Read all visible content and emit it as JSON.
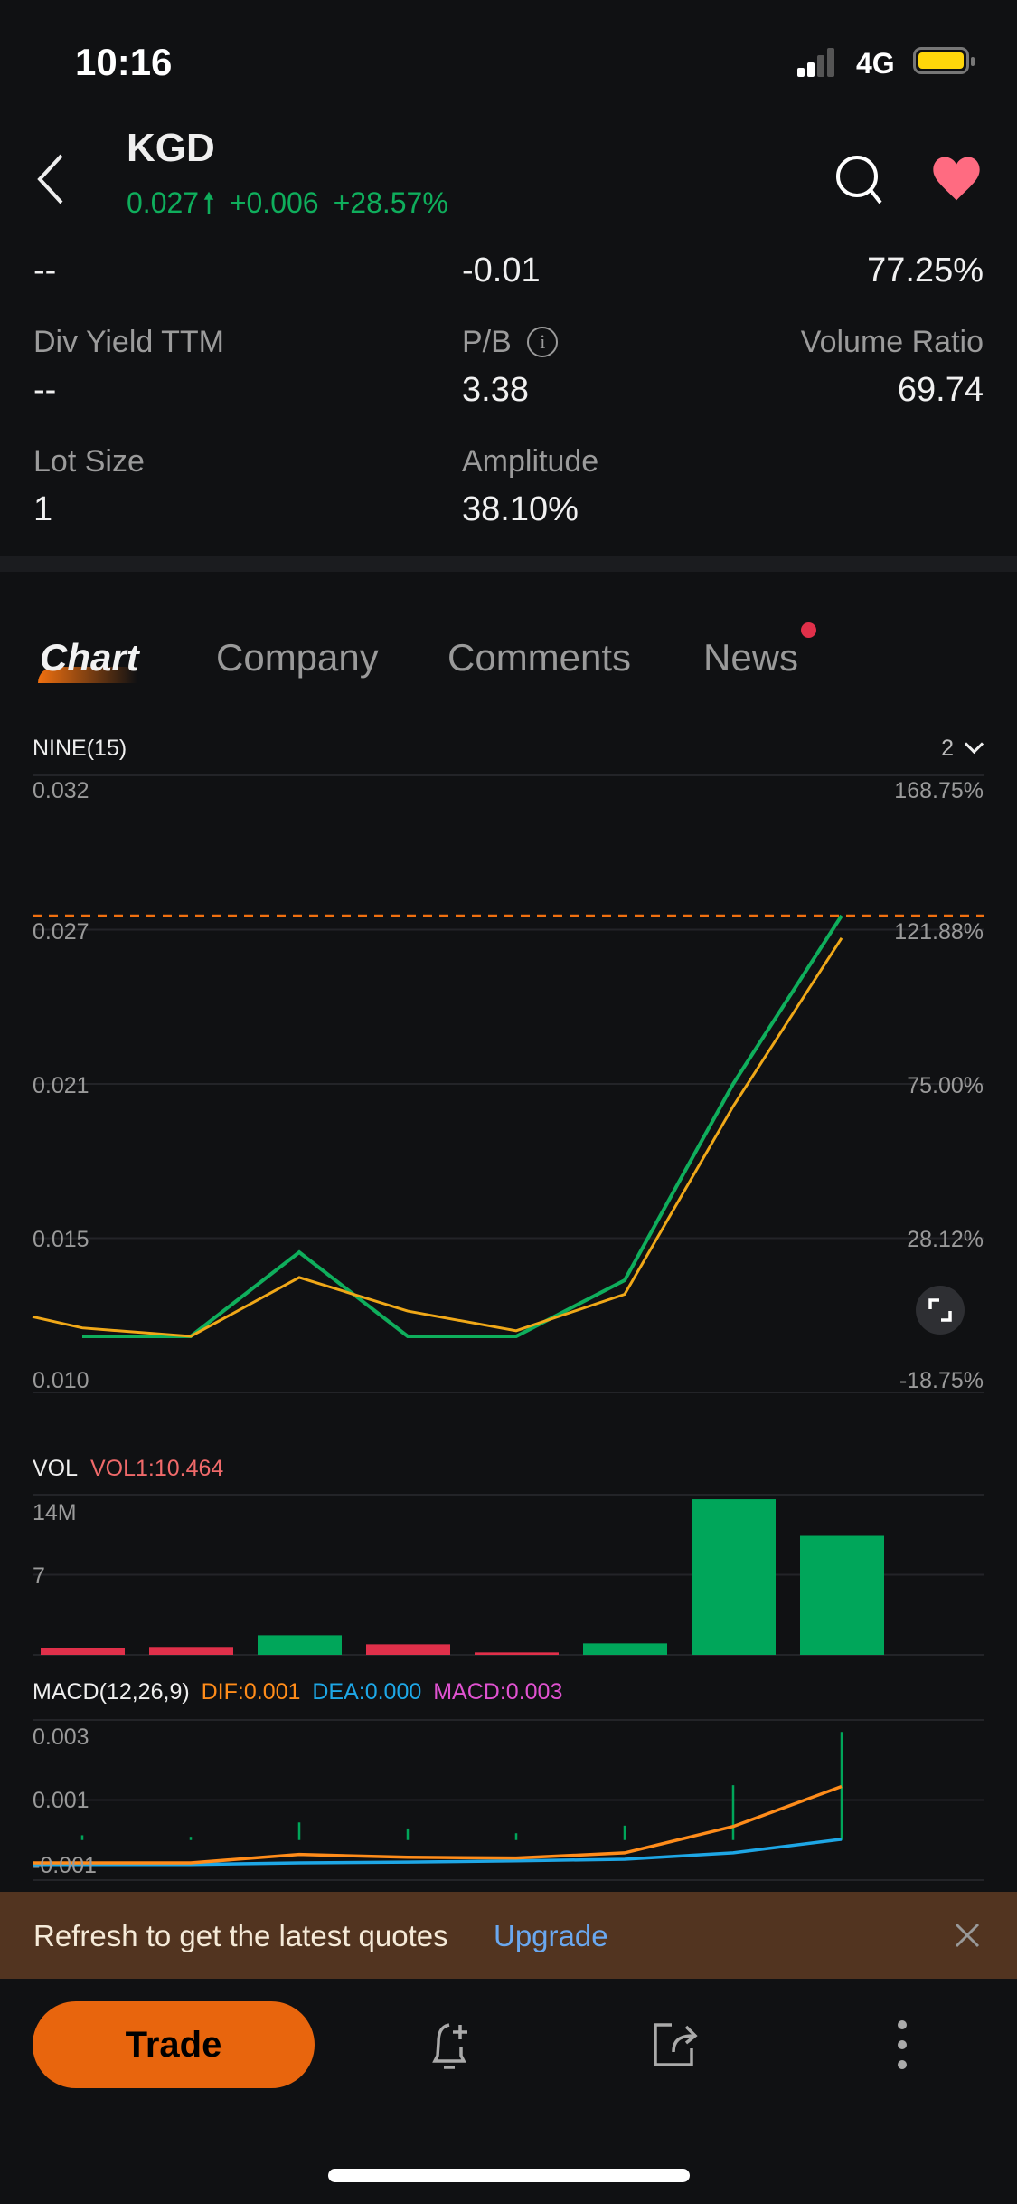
{
  "status_bar": {
    "time": "10:16",
    "network": "4G",
    "signal_bars": 2,
    "battery_color": "#ffd60a"
  },
  "header": {
    "ticker": "KGD",
    "price": "0.027",
    "change": "+0.006",
    "change_pct": "+28.57%",
    "up_color": "#0fae5c",
    "favorite_color": "#ff6b81"
  },
  "stats": {
    "row1": [
      "--",
      "-0.01",
      "77.25%"
    ],
    "row2": [
      {
        "label": "Div Yield TTM",
        "value": "--"
      },
      {
        "label": "P/B",
        "value": "3.38"
      },
      {
        "label": "Volume Ratio",
        "value": "69.74"
      }
    ],
    "row3": [
      {
        "label": "Lot Size",
        "value": "1"
      },
      {
        "label": "Amplitude",
        "value": "38.10%"
      }
    ]
  },
  "tabs": [
    {
      "label": "Chart",
      "active": true
    },
    {
      "label": "Company",
      "active": false
    },
    {
      "label": "Comments",
      "active": false
    },
    {
      "label": "News",
      "active": false,
      "badge": true
    }
  ],
  "chart_header": {
    "indicator": "NINE(15)",
    "selector": "2"
  },
  "chart_data": [
    {
      "type": "line",
      "name": "price",
      "y_ticks_left": [
        "0.032",
        "0.027",
        "0.021",
        "0.015",
        "0.010"
      ],
      "y_ticks_right": [
        "168.75%",
        "121.88%",
        "75.00%",
        "28.12%",
        "-18.75%"
      ],
      "ylim": [
        0.01,
        0.032
      ],
      "current_price_line": 0.027,
      "grid": true,
      "series": [
        {
          "color": "#0fae5c",
          "values": [
            0.012,
            0.012,
            0.015,
            0.012,
            0.012,
            0.014,
            0.021,
            0.027
          ]
        },
        {
          "color": "#f0a818",
          "values": [
            0.0123,
            0.012,
            0.0141,
            0.0129,
            0.0122,
            0.0135,
            0.0202,
            0.0262
          ],
          "lead_value": 0.0127
        }
      ]
    },
    {
      "type": "bar",
      "name": "VOL",
      "label": "VOL",
      "legend": "VOL1:10.464",
      "y_ticks": [
        "14M",
        "7"
      ],
      "ylim": [
        0,
        14
      ],
      "values": [
        0.61,
        0.69,
        1.71,
        0.92,
        0.21,
        1.0,
        13.6,
        10.4
      ],
      "directions": [
        "down",
        "down",
        "up",
        "down",
        "down",
        "up",
        "up",
        "up"
      ],
      "colors": {
        "up": "#00a65a",
        "down": "#e0304a"
      }
    },
    {
      "type": "line",
      "name": "MACD",
      "label": "MACD(12,26,9)",
      "legend": [
        {
          "text": "DIF:0.001",
          "color": "#ff8c1a"
        },
        {
          "text": "DEA:0.000",
          "color": "#1ea7e6"
        },
        {
          "text": "MACD:0.003",
          "color": "#e052d0"
        }
      ],
      "y_ticks": [
        "0.003",
        "0.001",
        "-0.001"
      ],
      "ylim": [
        -0.001,
        0.003
      ],
      "dif": [
        -0.00057,
        -0.00057,
        -0.00036,
        -0.00043,
        -0.00045,
        -0.00032,
        0.00034,
        0.00134
      ],
      "dea": [
        -0.00061,
        -0.00061,
        -0.00057,
        -0.00055,
        -0.00052,
        -0.00048,
        -0.00032,
        2e-05
      ],
      "histogram": [
        0.00012,
        8e-05,
        0.00044,
        0.00029,
        0.00017,
        0.00036,
        0.00137,
        0.0027
      ]
    }
  ],
  "banner": {
    "text": "Refresh to get the latest quotes",
    "link": "Upgrade"
  },
  "bottom_bar": {
    "trade_label": "Trade"
  }
}
